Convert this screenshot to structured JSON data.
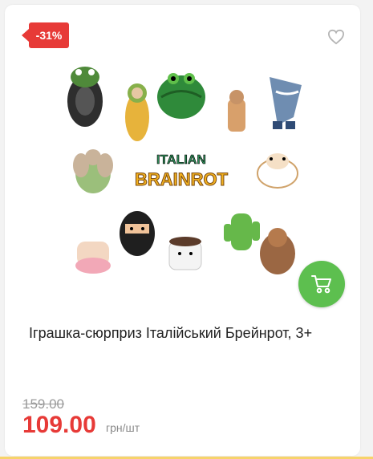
{
  "product": {
    "discount_badge": "-31%",
    "title": "Іграшка-сюрприз Італійський Брейнрот, 3+",
    "old_price": "159.00",
    "new_price": "109.00",
    "unit": "грн/шт",
    "image_logo_top": "ITALIAN",
    "image_logo_bottom": "BRAINROT"
  },
  "colors": {
    "accent": "#e73a37",
    "cart_button": "#5dbf4f",
    "bottom_strip": "#f7d36b"
  },
  "icons": {
    "favorite": "heart-icon",
    "cart": "cart-icon"
  }
}
